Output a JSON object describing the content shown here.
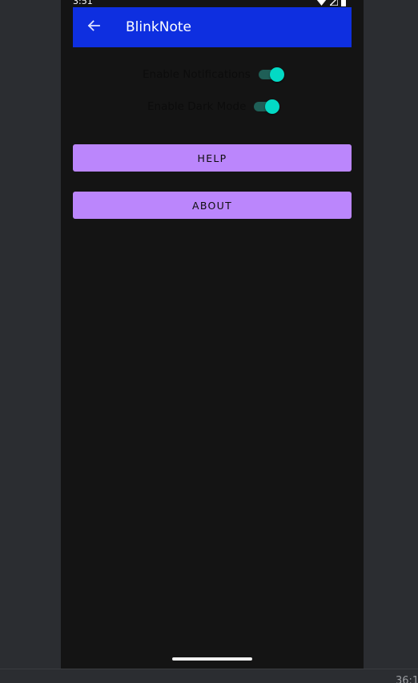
{
  "status_bar": {
    "time": "3:51",
    "icons": [
      "wifi-icon",
      "cell-signal-icon",
      "battery-icon"
    ]
  },
  "app_bar": {
    "back_icon": "arrow-back-icon",
    "title": "BlinkNote",
    "background_color": "#0e2fe0"
  },
  "settings": {
    "notifications": {
      "label": "Enable Notifications",
      "enabled": true
    },
    "dark_mode": {
      "label": "Enable Dark Mode",
      "enabled": true
    },
    "switch_color": "#03dac5"
  },
  "buttons": {
    "help_label": "HELP",
    "about_label": "ABOUT",
    "color": "#bb86fc"
  },
  "footer": {
    "text": "36:1"
  }
}
